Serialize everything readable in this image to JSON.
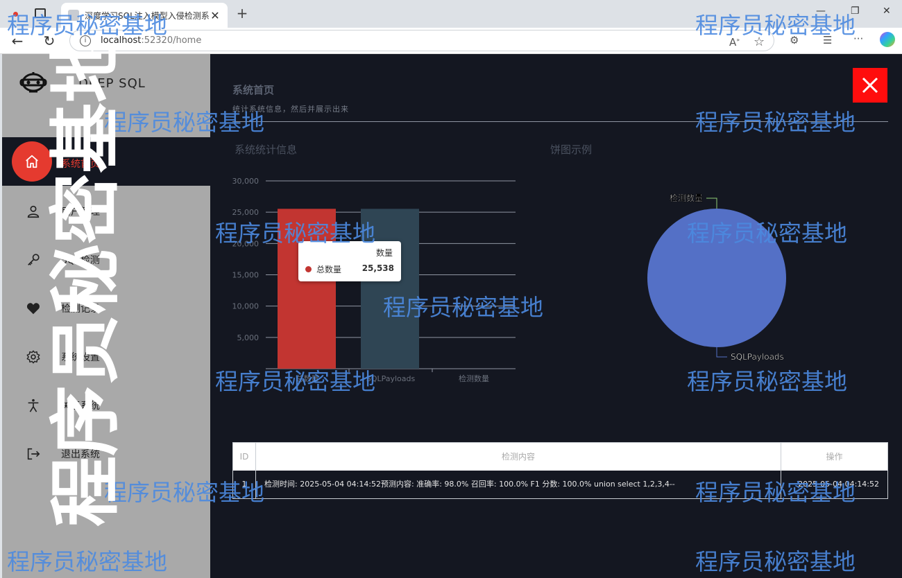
{
  "browser": {
    "tab_title": "深度学习SQL注入模型入侵检测系",
    "url_host": "localhost",
    "url_port_path": ":52320/home",
    "close_tab": "✕",
    "new_tab": "+",
    "win_min": "—",
    "win_max": "❐",
    "win_close": "✕"
  },
  "sidebar": {
    "brand": "DEEP SQL",
    "items": [
      {
        "label": "系统首页",
        "icon": "home-icon"
      },
      {
        "label": "用户管理",
        "icon": "user-icon"
      },
      {
        "label": "SQL检测",
        "icon": "key-icon"
      },
      {
        "label": "检测记录",
        "icon": "heart-icon"
      },
      {
        "label": "系统设置",
        "icon": "gear-icon"
      },
      {
        "label": "关于系统",
        "icon": "accessibility-icon"
      },
      {
        "label": "退出系统",
        "icon": "logout-icon"
      }
    ]
  },
  "main": {
    "title": "系统首页",
    "subtitle": "统计系统信息，然后并展示出来",
    "bar_section_title": "系统统计信息",
    "pie_section_title": "饼图示例"
  },
  "chart_data": [
    {
      "type": "bar",
      "categories": [
        "总数量",
        "SQLPayloads",
        "检测数量"
      ],
      "series": [
        {
          "name": "数量",
          "values": [
            25538,
            25538,
            0
          ]
        }
      ],
      "colors": [
        "#c23531",
        "#2f4554"
      ],
      "ylim": [
        0,
        30000
      ],
      "yticks": [
        "5,000",
        "10,000",
        "15,000",
        "20,000",
        "25,000",
        "30,000"
      ],
      "grid": true,
      "tooltip": {
        "header": "数量",
        "name": "总数量",
        "value": "25,538"
      }
    },
    {
      "type": "pie",
      "slices": [
        {
          "name": "SQLPayloads",
          "value": 25538,
          "color": "#5470c6"
        },
        {
          "name": "检测数量",
          "value": 0,
          "color": "#91cc75"
        }
      ]
    }
  ],
  "table": {
    "headers": [
      "ID",
      "检测内容",
      "操作"
    ],
    "rows": [
      {
        "id": "1",
        "content": "检测时间: 2025-05-04 04:14:52预测内容: 准确率: 98.0% 召回率: 100.0% F1 分数: 100.0% union select 1,2,3,4--",
        "op": "2025-05-04 04:14:52"
      }
    ]
  },
  "watermark": "程序员秘密基地",
  "watermark_vertical": "程序员秘密基地"
}
